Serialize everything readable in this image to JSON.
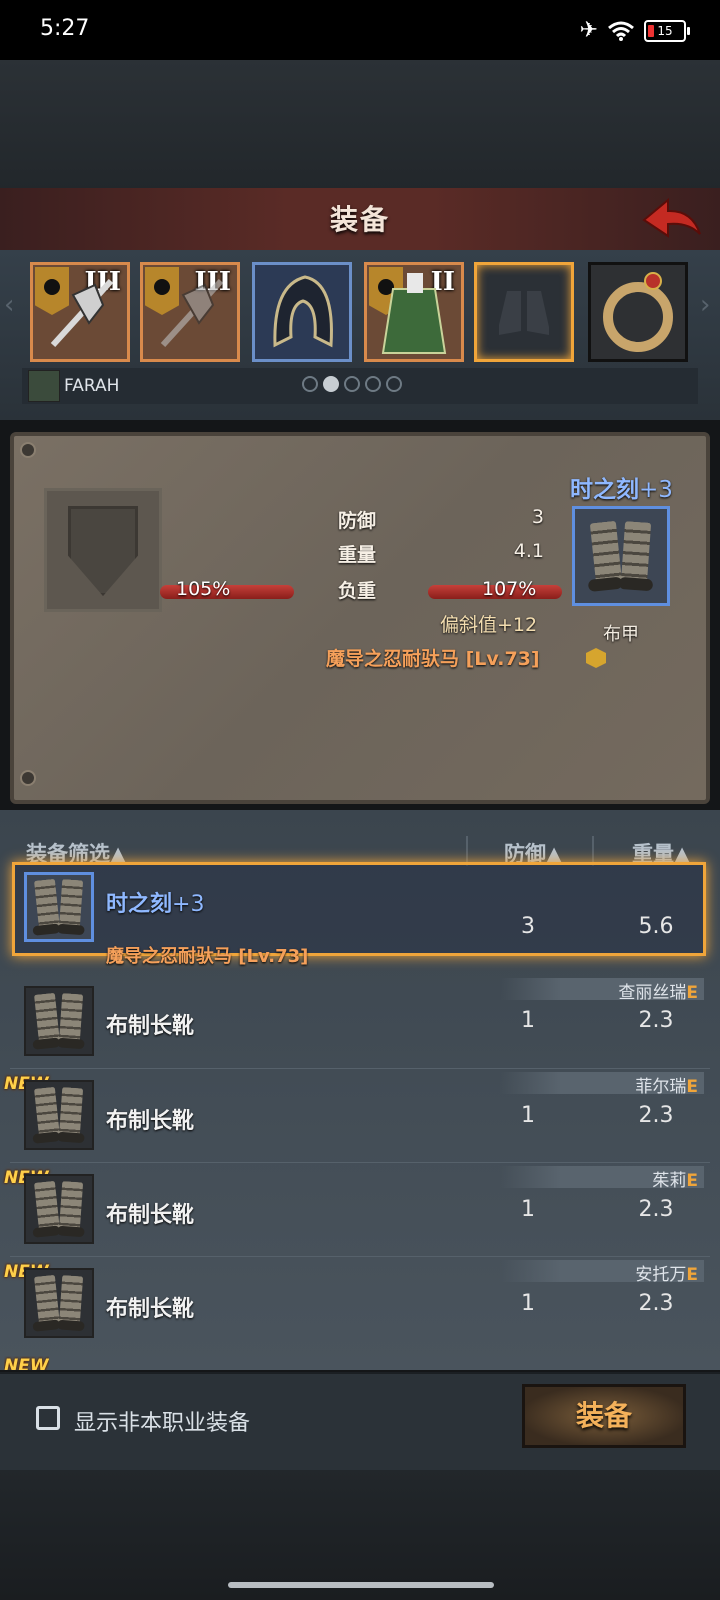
{
  "status": {
    "time": "5:27",
    "battery": "15"
  },
  "header": {
    "title": "装备"
  },
  "slots": [
    {
      "rank": "III",
      "name": "weapon-halberd"
    },
    {
      "rank": "III",
      "name": "weapon-halberd-2"
    },
    {
      "rank": "",
      "name": "hood"
    },
    {
      "rank": "II",
      "name": "armor"
    },
    {
      "rank": "",
      "name": "boots-empty"
    },
    {
      "rank": "",
      "name": "amulet"
    }
  ],
  "hero": {
    "name": "FARAH"
  },
  "compare": {
    "defense_label": "防御",
    "defense_value": "3",
    "weight_label": "重量",
    "weight_value": "4.1",
    "load_label": "负重",
    "load_left": "105%",
    "load_right": "107%",
    "bonus": "偏斜值+12",
    "set_name": "魔导之忍耐驮马 [Lv.73]",
    "item_name": "时之刻",
    "item_plus": "+3",
    "item_type": "布甲"
  },
  "list": {
    "filter_label": "装备筛选▲",
    "col_defense": "防御▲",
    "col_weight": "重量▲",
    "rows": [
      {
        "name": "时之刻",
        "plus": "+3",
        "set": "魔导之忍耐驮马 [Lv.73]",
        "defense": "3",
        "weight": "5.6"
      },
      {
        "name": "布制长靴",
        "owner": "查丽丝瑞",
        "owner_grade": "E",
        "defense": "1",
        "weight": "2.3"
      },
      {
        "name": "布制长靴",
        "owner": "菲尔瑞",
        "owner_grade": "E",
        "defense": "1",
        "weight": "2.3",
        "badge": "NEW"
      },
      {
        "name": "布制长靴",
        "owner": "茱莉",
        "owner_grade": "E",
        "defense": "1",
        "weight": "2.3",
        "badge": "NEW"
      },
      {
        "name": "布制长靴",
        "owner": "安托万",
        "owner_grade": "E",
        "defense": "1",
        "weight": "2.3",
        "badge": "NEW"
      }
    ],
    "cut_badge": "NEW"
  },
  "footer": {
    "checkbox_label": "显示非本职业装备",
    "equip_button": "装备"
  }
}
